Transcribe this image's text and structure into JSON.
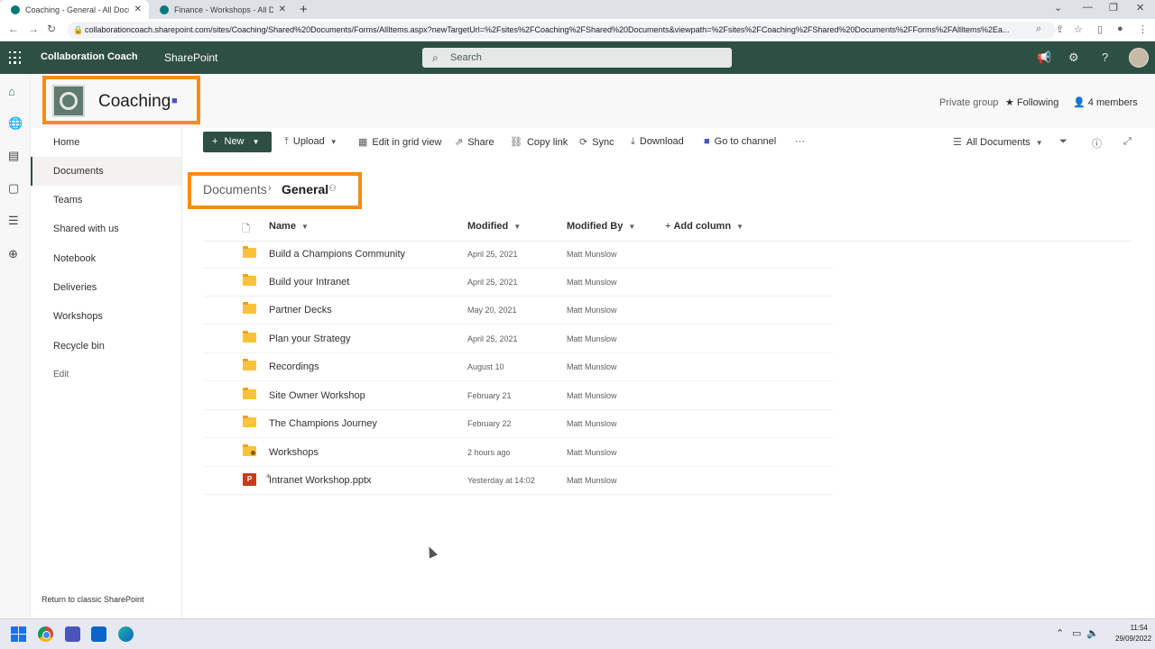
{
  "browser": {
    "tabs": [
      {
        "title": "Coaching - General - All Docume",
        "active": true
      },
      {
        "title": "Finance - Workshops - All Docur",
        "active": false
      }
    ],
    "url": "collaborationcoach.sharepoint.com/sites/Coaching/Shared%20Documents/Forms/AllItems.aspx?newTargetUrl=%2Fsites%2FCoaching%2FShared%20Documents&viewpath=%2Fsites%2FCoaching%2FShared%20Documents%2FForms%2FAllItems%2Ea..."
  },
  "suitebar": {
    "org_name": "Collaboration Coach",
    "app_name": "SharePoint",
    "search_placeholder": "Search"
  },
  "site": {
    "title": "Coaching",
    "privacy": "Private group",
    "following": "Following",
    "members": "4 members"
  },
  "nav": {
    "items": [
      "Home",
      "Documents",
      "Teams",
      "Shared with us",
      "Notebook",
      "Deliveries",
      "Workshops",
      "Recycle bin"
    ],
    "selected": "Documents",
    "edit": "Edit",
    "return_classic": "Return to classic SharePoint"
  },
  "commandbar": {
    "new": "New",
    "upload": "Upload",
    "edit_grid": "Edit in grid view",
    "share": "Share",
    "copy_link": "Copy link",
    "sync": "Sync",
    "download": "Download",
    "go_to_channel": "Go to channel",
    "more": "···",
    "view": "All Documents"
  },
  "breadcrumb": {
    "root": "Documents",
    "current": "General"
  },
  "list": {
    "columns": {
      "name": "Name",
      "modified": "Modified",
      "modified_by": "Modified By",
      "add_column": "Add column"
    },
    "rows": [
      {
        "name": "Build a Champions Community",
        "modified": "April 25, 2021",
        "modified_by": "Matt Munslow",
        "type": "folder"
      },
      {
        "name": "Build your Intranet",
        "modified": "April 25, 2021",
        "modified_by": "Matt Munslow",
        "type": "folder"
      },
      {
        "name": "Partner Decks",
        "modified": "May 20, 2021",
        "modified_by": "Matt Munslow",
        "type": "folder"
      },
      {
        "name": "Plan your Strategy",
        "modified": "April 25, 2021",
        "modified_by": "Matt Munslow",
        "type": "folder"
      },
      {
        "name": "Recordings",
        "modified": "August 10",
        "modified_by": "Matt Munslow",
        "type": "folder"
      },
      {
        "name": "Site Owner Workshop",
        "modified": "February 21",
        "modified_by": "Matt Munslow",
        "type": "folder"
      },
      {
        "name": "The Champions Journey",
        "modified": "February 22",
        "modified_by": "Matt Munslow",
        "type": "folder"
      },
      {
        "name": "Workshops",
        "modified": "2 hours ago",
        "modified_by": "Matt Munslow",
        "type": "shared-folder"
      },
      {
        "name": "Intranet Workshop.pptx",
        "modified": "Yesterday at 14:02",
        "modified_by": "Matt Munslow",
        "type": "pptx"
      }
    ]
  },
  "taskbar": {
    "time": "11:54",
    "date": "29/09/2022"
  },
  "colors": {
    "suitebar": "#2e4f44",
    "highlight": "#f28c1b",
    "folder": "#f8c33a",
    "pptx": "#c43e1c"
  }
}
